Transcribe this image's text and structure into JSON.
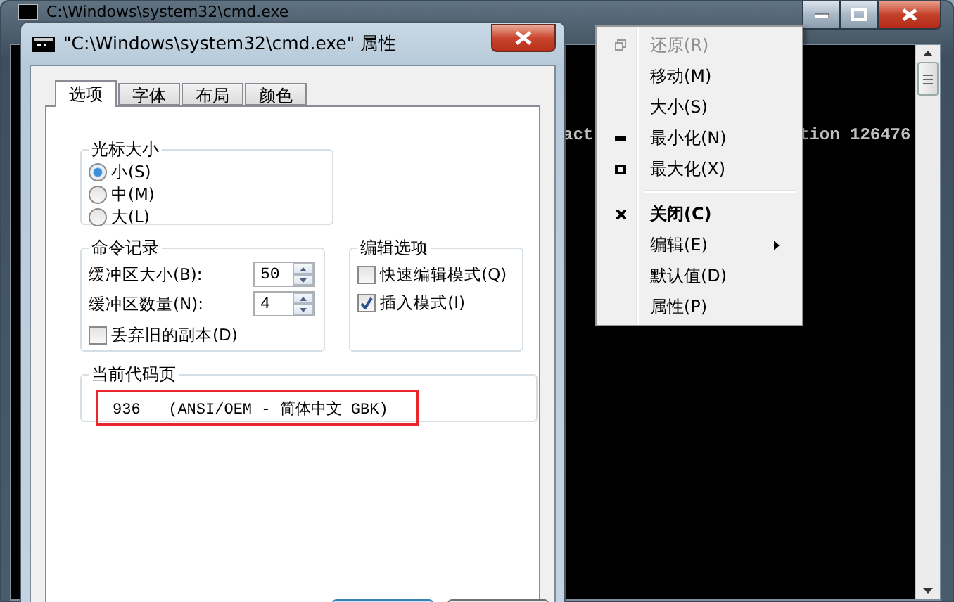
{
  "background_window": {
    "title": "C:\\Windows\\system32\\cmd.exe",
    "console_fragments": [
      "act",
      "tion 126476"
    ]
  },
  "dialog": {
    "title": "\"C:\\Windows\\system32\\cmd.exe\" 属性",
    "tabs": [
      {
        "label": "选项",
        "selected": true
      },
      {
        "label": "字体",
        "selected": false
      },
      {
        "label": "布局",
        "selected": false
      },
      {
        "label": "颜色",
        "selected": false
      }
    ],
    "cursor_size": {
      "title": "光标大小",
      "options": [
        {
          "label": "小(S)",
          "selected": true
        },
        {
          "label": "中(M)",
          "selected": false
        },
        {
          "label": "大(L)",
          "selected": false
        }
      ]
    },
    "command_history": {
      "title": "命令记录",
      "fields": [
        {
          "label": "缓冲区大小(B):",
          "value": "50"
        },
        {
          "label": "缓冲区数量(N):",
          "value": "4"
        }
      ],
      "discard": {
        "label": "丢弃旧的副本(D)",
        "checked": false
      }
    },
    "edit_options": {
      "title": "编辑选项",
      "options": [
        {
          "label": "快速编辑模式(Q)",
          "checked": false
        },
        {
          "label": "插入模式(I)",
          "checked": true
        }
      ]
    },
    "code_page": {
      "title": "当前代码页",
      "value": "936   (ANSI/OEM - 简体中文 GBK)",
      "highlighted": true
    }
  },
  "context_menu": {
    "items": [
      {
        "kind": "item",
        "label": "还原(R)",
        "disabled": true,
        "default": false,
        "submenu": false
      },
      {
        "kind": "item",
        "label": "移动(M)",
        "disabled": false,
        "default": false,
        "submenu": false
      },
      {
        "kind": "item",
        "label": "大小(S)",
        "disabled": false,
        "default": false,
        "submenu": false
      },
      {
        "kind": "item",
        "label": "最小化(N)",
        "disabled": false,
        "default": false,
        "submenu": false
      },
      {
        "kind": "item",
        "label": "最大化(X)",
        "disabled": false,
        "default": false,
        "submenu": false
      },
      {
        "kind": "separator"
      },
      {
        "kind": "item",
        "label": "关闭(C)",
        "disabled": false,
        "default": true,
        "submenu": false
      },
      {
        "kind": "item",
        "label": "编辑(E)",
        "disabled": false,
        "default": false,
        "submenu": true
      },
      {
        "kind": "item",
        "label": "默认值(D)",
        "disabled": false,
        "default": false,
        "submenu": false
      },
      {
        "kind": "item",
        "label": "属性(P)",
        "disabled": false,
        "default": false,
        "submenu": false
      }
    ]
  }
}
